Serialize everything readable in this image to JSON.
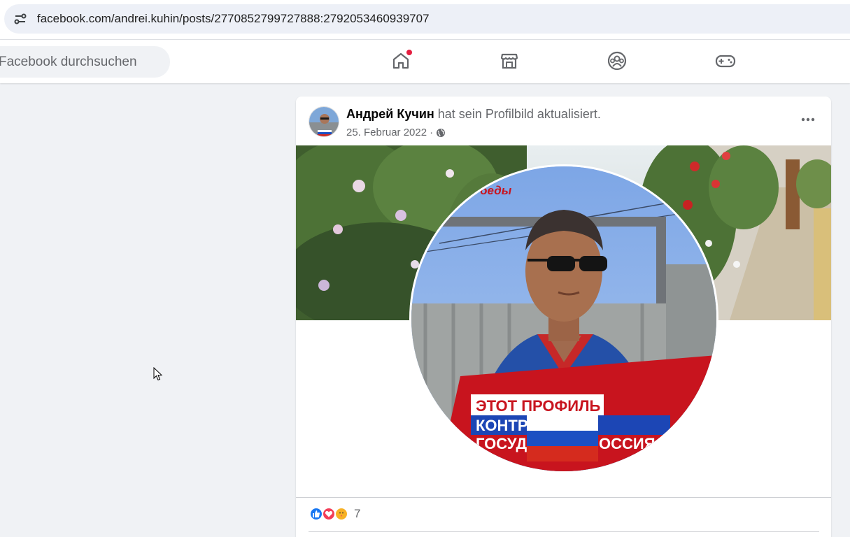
{
  "browser": {
    "url": "facebook.com/andrei.kuhin/posts/2770852799727888:2792053460939707"
  },
  "nav": {
    "search_placeholder": "Facebook durchsuchen",
    "icons": [
      "home-icon",
      "marketplace-icon",
      "groups-icon",
      "gaming-icon"
    ],
    "home_has_notification": true
  },
  "post": {
    "author": "Андрей Кучин",
    "action": "hat sein Profilbild aktualisiert.",
    "date": "25. Februar 2022",
    "separator": "·",
    "privacy_icon": "globe-icon",
    "frame_text_lines": [
      "ЭТОТ ПРОФИЛЬ",
      "КОНТРО",
      "ГОСУДА",
      "ОССИЯ"
    ],
    "photo_sign": "беды",
    "reactions": [
      "like",
      "love",
      "care"
    ],
    "reaction_count": "7"
  },
  "colors": {
    "accent": "#1877f2",
    "notification": "#e41e3f",
    "love": "#f33e58",
    "care": "#f7b125"
  }
}
